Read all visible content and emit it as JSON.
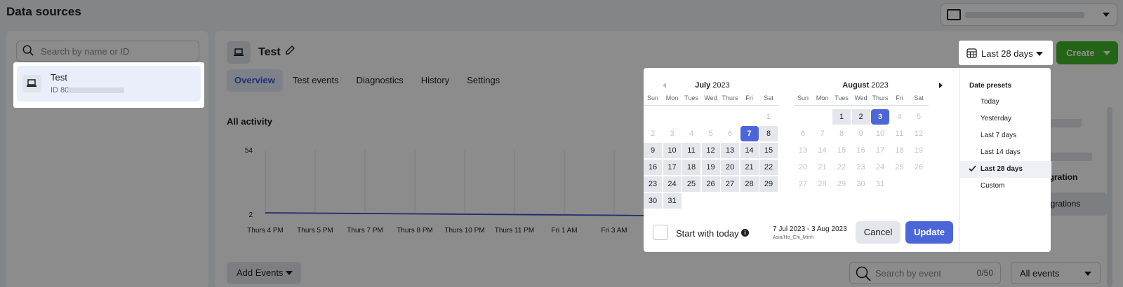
{
  "header": {
    "title": "Data sources"
  },
  "left": {
    "search_placeholder": "Search by name or ID",
    "source": {
      "name": "Test",
      "id_prefix": "ID 80"
    }
  },
  "main": {
    "title": "Test",
    "tabs": [
      "Overview",
      "Test events",
      "Diagnostics",
      "History",
      "Settings"
    ],
    "date_button": "Last 28 days",
    "create_button": "Create",
    "activity_title": "All activity",
    "right_fragment": "tegration",
    "integrations_button": "egrations",
    "add_events": "Add Events",
    "event_search_placeholder": "Search by event",
    "event_count": "0/50",
    "all_events": "All events"
  },
  "chart_data": {
    "type": "line",
    "x": [
      "Thurs 4 PM",
      "Thurs 5 PM",
      "Thurs 7 PM",
      "Thurs 8 PM",
      "Thurs 10 PM",
      "Thurs 11 PM",
      "Fri 1 AM",
      "Fri 3 AM"
    ],
    "y_ticks": [
      "54",
      "2"
    ],
    "series": [
      {
        "values": [
          2,
          2,
          2,
          2,
          2,
          2,
          2,
          2
        ]
      }
    ],
    "ylim": [
      2,
      54
    ],
    "line_color": "#3b4ccf"
  },
  "datepicker": {
    "weekdays": [
      "Sun",
      "Mon",
      "Tues",
      "Wed",
      "Thurs",
      "Fri",
      "Sat"
    ],
    "months": [
      {
        "name": "July",
        "year": "2023",
        "first_weekday": 6,
        "days": 31,
        "range_start": 7,
        "range_end": 31
      },
      {
        "name": "August",
        "year": "2023",
        "first_weekday": 2,
        "days": 31,
        "range_start": 1,
        "range_end": 3
      }
    ],
    "start_with_today": "Start with today",
    "info_icon": "i",
    "range_text": "7 Jul 2023 - 3 Aug 2023",
    "timezone": "Asia/Ho_Chi_Minh",
    "cancel": "Cancel",
    "update": "Update",
    "presets_title": "Date presets",
    "presets": [
      "Today",
      "Yesterday",
      "Last 7 days",
      "Last 14 days",
      "Last 28 days",
      "Custom"
    ],
    "active_preset": "Last 28 days",
    "accent": "#4c66d9"
  }
}
